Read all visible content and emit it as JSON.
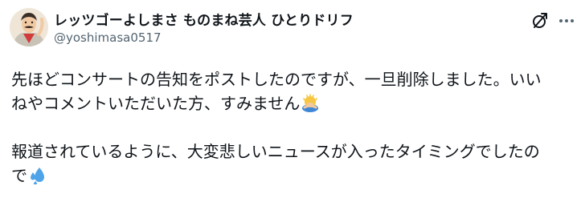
{
  "post": {
    "author": {
      "display_name": "レッツゴーよしまさ ものまね芸人 ひとりドリフ",
      "handle": "@yoshimasa0517"
    },
    "actions": {
      "grok_icon": "grok-icon",
      "more_icon": "more-dots-icon"
    },
    "body": {
      "para1_line1": "先ほどコンサートの告知をポストしたのですが、一旦削除しました。いい",
      "para1_line2": "ねやコメントいただいた方、すみません",
      "para1_emoji": "person-bowing-emoji",
      "para2_line1": "報道されているように、大変悲しいニュースが入ったタイミングでしたの",
      "para2_line2": "で",
      "para2_emoji": "sweat-droplets-emoji"
    }
  },
  "colors": {
    "text": "#0f1419",
    "secondary_text": "#536471",
    "background": "#ffffff"
  }
}
